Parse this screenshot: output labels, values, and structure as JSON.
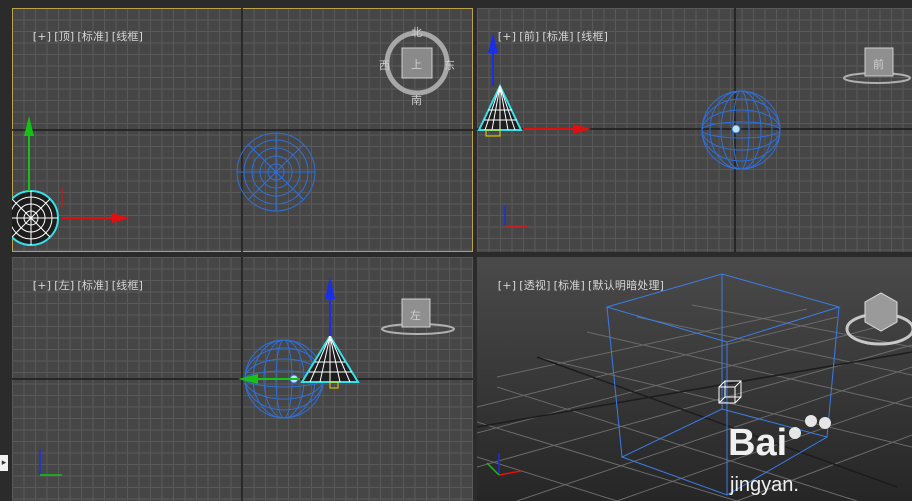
{
  "viewports": {
    "top": {
      "labels": [
        "[+]",
        "[顶]",
        "[标准]",
        "[线框]"
      ],
      "viewcube": {
        "n": "北",
        "s": "南",
        "w": "西",
        "e": "东",
        "face": "上"
      }
    },
    "front": {
      "labels": [
        "[+]",
        "[前]",
        "[标准]",
        "[线框]"
      ],
      "viewcube": {
        "face": "前"
      }
    },
    "left": {
      "labels": [
        "[+]",
        "[左]",
        "[标准]",
        "[线框]"
      ],
      "viewcube": {
        "face": "左"
      }
    },
    "perspective": {
      "labels": [
        "[+]",
        "[透视]",
        "[标准]",
        "[默认明暗处理]"
      ]
    }
  },
  "axes": {
    "x": "x",
    "y": "y",
    "z": "z"
  },
  "watermark": {
    "brand": "Bai",
    "sub": "jingyan."
  },
  "colors": {
    "active_border": "#b9a350",
    "sphere": "#2f6fd8",
    "cone": "#ffffff",
    "cone_outline": "#36e0e8",
    "x_axis": "#e01010",
    "y_axis": "#16c016",
    "z_axis": "#1a2ee8"
  }
}
